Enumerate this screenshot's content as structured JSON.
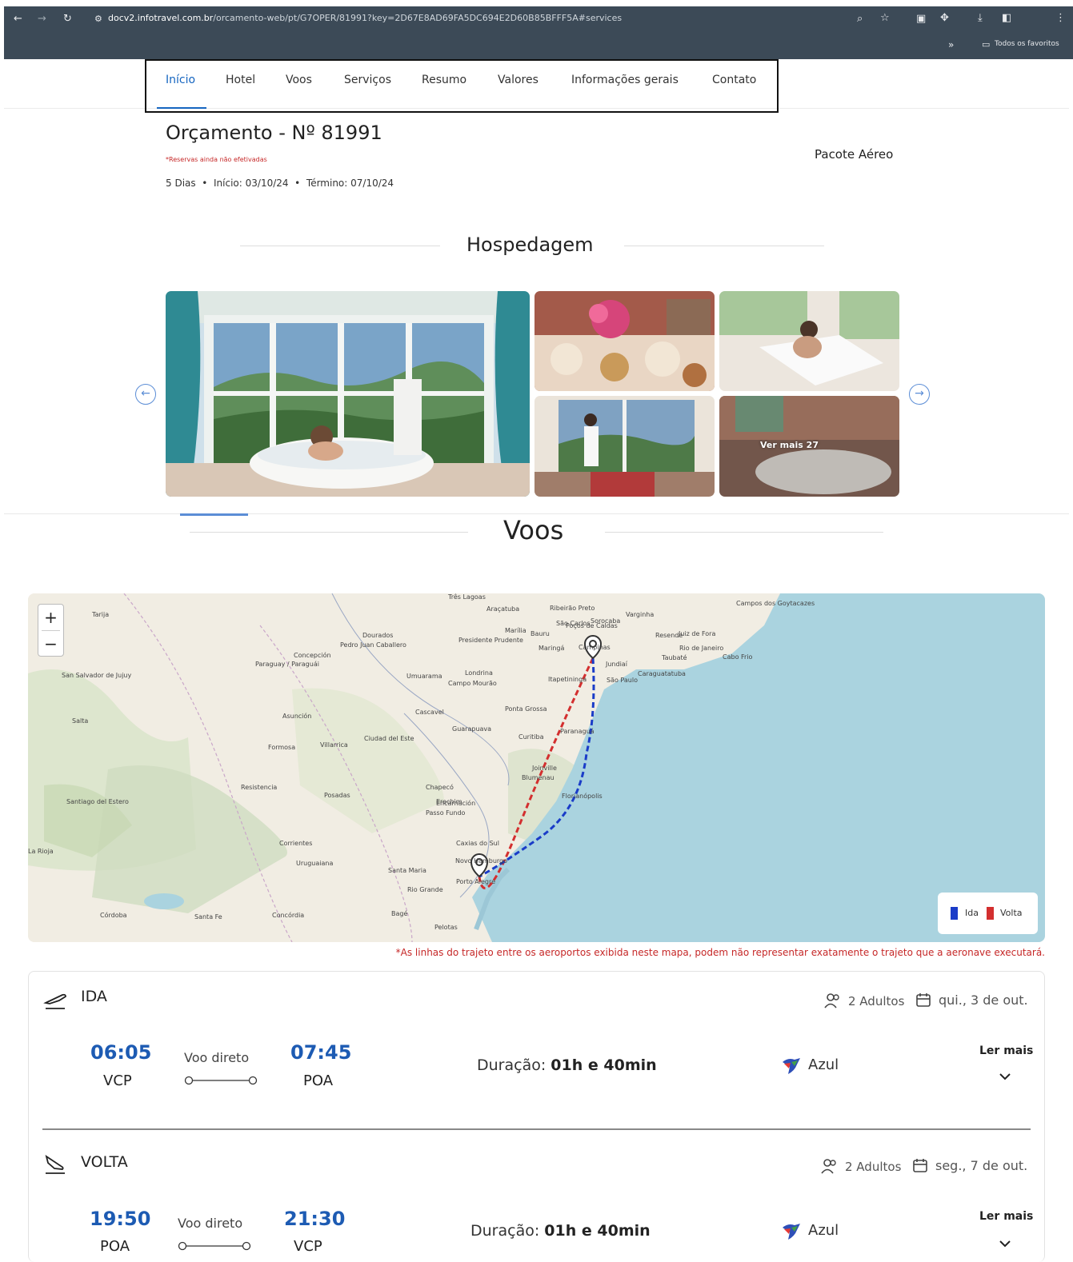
{
  "browser": {
    "url_domain": "docv2.infotravel.com.br",
    "url_path": "/orcamento-web/pt/G7OPER/81991?key=2D67E8AD69FA5DC694E2D60B85BFFF5A#services",
    "bookmarks_label": "Todos os favoritos"
  },
  "nav": {
    "items": [
      "Início",
      "Hotel",
      "Voos",
      "Serviços",
      "Resumo",
      "Valores",
      "Informações gerais",
      "Contato"
    ],
    "active": "Início"
  },
  "quote": {
    "title": "Orçamento - Nº 81991",
    "warning": "*Reservas ainda não efetivadas",
    "days": "5 Dias",
    "start": "Início: 03/10/24",
    "end": "Término: 07/10/24",
    "package": "Pacote Aéreo"
  },
  "hospedagem": {
    "title": "Hospedagem",
    "more_photos": "Ver mais 27"
  },
  "voos": {
    "title": "Voos",
    "map": {
      "legend_ida": "Ida",
      "legend_volta": "Volta",
      "color_ida": "#1a3cc8",
      "color_volta": "#d32f2f",
      "note": "*As linhas do trajeto entre os aeroportos exibida neste mapa, podem não representar exatamente o trajeto que a aeronave executará.",
      "labels": [
        "Três Lagoas",
        "Araçatuba",
        "Ribeirão Preto",
        "São Carlos",
        "Campinas",
        "Jundiaí",
        "São Paulo",
        "Taubaté",
        "Rio de Janeiro",
        "Juiz de Fora",
        "Campos dos Goytacazes",
        "Presidente Prudente",
        "Marília",
        "Bauru",
        "Londrina",
        "Umuarama",
        "Maringá",
        "Curitiba",
        "Joinville",
        "Florianópolis",
        "Chapecó",
        "Passo Fundo",
        "Caxias do Sul",
        "Novo Hamburgo",
        "Porto Alegre",
        "Santa Maria",
        "Pelotas",
        "Rio Grande",
        "Posadas",
        "Encarnación",
        "Asunción",
        "Formosa",
        "Resistencia",
        "Corrientes",
        "Santa Fe",
        "Córdoba",
        "Salta",
        "San Salvador de Jujuy",
        "Tarija",
        "Paraguay / Paraguái",
        "Concepción",
        "Pedro Juan Caballero",
        "Dourados",
        "Ciudad del Este",
        "Uruguaiana",
        "Bagé",
        "Santiago del Estero",
        "La Rioja",
        "Villarrica",
        "Caraguatatuba",
        "Cabo Frio",
        "Resende",
        "Itapetininga",
        "Paranaguá",
        "Guarapuava",
        "Cascavel",
        "Campo Mourão",
        "Ponta Grossa",
        "Blumenau",
        "Erechim",
        "Concórdia",
        "Sorocaba",
        "Varginha",
        "Poços de Caldas"
      ]
    },
    "flights": [
      {
        "label": "IDA",
        "adults": "2 Adultos",
        "date": "qui., 3 de out.",
        "dep_time": "06:05",
        "dep_code": "VCP",
        "type": "Voo direto",
        "arr_time": "07:45",
        "arr_code": "POA",
        "duration_label": "Duração:",
        "duration": "01h e 40min",
        "airline": "Azul",
        "more": "Ler mais"
      },
      {
        "label": "VOLTA",
        "adults": "2 Adultos",
        "date": "seg., 7 de out.",
        "dep_time": "19:50",
        "dep_code": "POA",
        "type": "Voo direto",
        "arr_time": "21:30",
        "arr_code": "VCP",
        "duration_label": "Duração:",
        "duration": "01h e 40min",
        "airline": "Azul",
        "more": "Ler mais"
      }
    ]
  }
}
